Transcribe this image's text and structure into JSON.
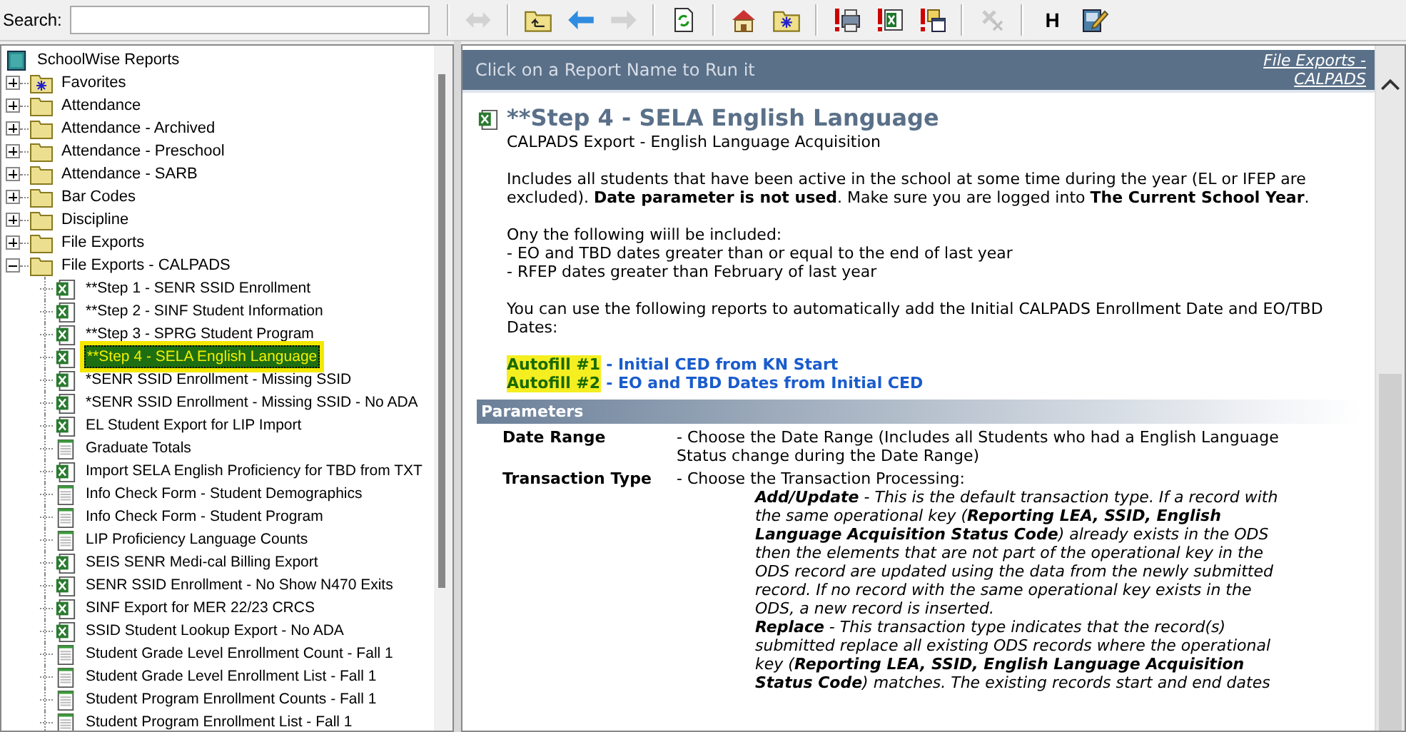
{
  "toolbar": {
    "search_label": "Search:",
    "groups": [
      [
        {
          "kind": "swap",
          "disabled": true
        }
      ],
      [
        {
          "kind": "up-folder",
          "disabled": false
        },
        {
          "kind": "back",
          "disabled": false
        },
        {
          "kind": "forward",
          "disabled": true
        }
      ],
      [
        {
          "kind": "refresh",
          "disabled": false
        }
      ],
      [
        {
          "kind": "home",
          "disabled": false
        },
        {
          "kind": "favorites",
          "disabled": false
        }
      ],
      [
        {
          "kind": "print",
          "disabled": false
        },
        {
          "kind": "excel",
          "disabled": false
        },
        {
          "kind": "schedule",
          "disabled": false
        }
      ],
      [
        {
          "kind": "clear",
          "disabled": true
        }
      ],
      [
        {
          "kind": "text",
          "label": "H",
          "disabled": false
        },
        {
          "kind": "notes",
          "disabled": false
        }
      ]
    ]
  },
  "tree": {
    "label": "SchoolWise Reports",
    "children": [
      {
        "label": "Favorites",
        "kind": "favorites",
        "expanded": false
      },
      {
        "label": "Attendance",
        "kind": "folder",
        "expanded": false
      },
      {
        "label": "Attendance - Archived",
        "kind": "folder",
        "expanded": false
      },
      {
        "label": "Attendance - Preschool",
        "kind": "folder",
        "expanded": false
      },
      {
        "label": "Attendance - SARB",
        "kind": "folder",
        "expanded": false
      },
      {
        "label": "Bar Codes",
        "kind": "folder",
        "expanded": false
      },
      {
        "label": "Discipline",
        "kind": "folder",
        "expanded": false
      },
      {
        "label": "File Exports",
        "kind": "folder",
        "expanded": false
      },
      {
        "label": "File Exports - CALPADS",
        "kind": "folder",
        "expanded": true,
        "children": [
          {
            "label": "**Step 1 - SENR SSID Enrollment",
            "kind": "excel",
            "selected": false
          },
          {
            "label": "**Step 2 - SINF Student Information",
            "kind": "excel",
            "selected": false
          },
          {
            "label": "**Step 3 - SPRG Student Program",
            "kind": "excel",
            "selected": false
          },
          {
            "label": "**Step 4 - SELA English Language",
            "kind": "excel",
            "selected": true
          },
          {
            "label": "*SENR SSID Enrollment - Missing SSID",
            "kind": "excel",
            "selected": false
          },
          {
            "label": "*SENR SSID Enrollment - Missing SSID - No ADA",
            "kind": "excel",
            "selected": false
          },
          {
            "label": "EL Student Export for LIP Import",
            "kind": "excel",
            "selected": false
          },
          {
            "label": "Graduate Totals",
            "kind": "report",
            "selected": false
          },
          {
            "label": "Import SELA English Proficiency for TBD from TXT",
            "kind": "excel",
            "selected": false
          },
          {
            "label": "Info Check Form - Student Demographics",
            "kind": "report",
            "selected": false
          },
          {
            "label": "Info Check Form - Student Program",
            "kind": "report",
            "selected": false
          },
          {
            "label": "LIP Proficiency Language Counts",
            "kind": "report",
            "selected": false
          },
          {
            "label": "SEIS SENR Medi-cal Billing Export",
            "kind": "excel",
            "selected": false
          },
          {
            "label": "SENR SSID Enrollment - No Show N470 Exits",
            "kind": "excel",
            "selected": false
          },
          {
            "label": "SINF Export for MER 22/23 CRCS",
            "kind": "excel",
            "selected": false
          },
          {
            "label": "SSID Student Lookup Export - No ADA",
            "kind": "excel",
            "selected": false
          },
          {
            "label": "Student Grade Level Enrollment Count - Fall 1",
            "kind": "report",
            "selected": false
          },
          {
            "label": "Student Grade Level Enrollment List - Fall 1",
            "kind": "report",
            "selected": false
          },
          {
            "label": "Student Program Enrollment Counts - Fall 1",
            "kind": "report",
            "selected": false
          },
          {
            "label": "Student Program Enrollment List - Fall 1",
            "kind": "report",
            "selected": false
          }
        ]
      }
    ]
  },
  "report": {
    "header": "Click on a Report Name to Run it",
    "breadcrumb": "File Exports - CALPADS",
    "title": "**Step 4 - SELA English Language",
    "subtitle": "CALPADS Export - English Language Acquisition",
    "intro": "Includes all students that have been active in the school at some time during the year (EL or IFEP are excluded). **Date parameter is not used**. Make sure you are logged into **The Current School Year**.",
    "criteria": [
      "Ony the following wiill be included:",
      "- EO and TBD dates greater than or equal to the end of last year",
      "- RFEP dates greater than February of last year"
    ],
    "autofill_note": "You can use the following reports to automatically add the Initial CALPADS Enrollment Date and EO/TBD Dates:",
    "autofills": [
      {
        "label": "Autofill #1",
        "highlighted": true,
        "link": "- Initial CED from KN Start"
      },
      {
        "label": "Autofill #2",
        "highlighted": true,
        "link": "- EO and TBD Dates from Initial CED"
      }
    ],
    "parameters": {
      "heading": "Parameters",
      "items": [
        {
          "name": "Date Range",
          "description": "- Choose the Date Range (Includes all Students who had a English Language Status change during the Date Range)"
        },
        {
          "name": "Transaction Type",
          "description": "- Choose the Transaction Processing:",
          "options": [
            "**Add/Update** - This is the default transaction type. If a record with the same operational key (**Reporting LEA, SSID, English Language Acquisition Status Code**) already exists in the ODS then the elements that are not part of the operational key in the ODS record are updated using the data from the newly submitted record. If no record with the same operational key exists in the ODS, a new record is inserted.",
            "**Replace** - This transaction type indicates that the record(s) submitted replace all existing ODS records where the operational key (**Reporting LEA, SSID, English Language Acquisition Status Code**) matches. The existing records start and end dates"
          ]
        }
      ]
    }
  }
}
